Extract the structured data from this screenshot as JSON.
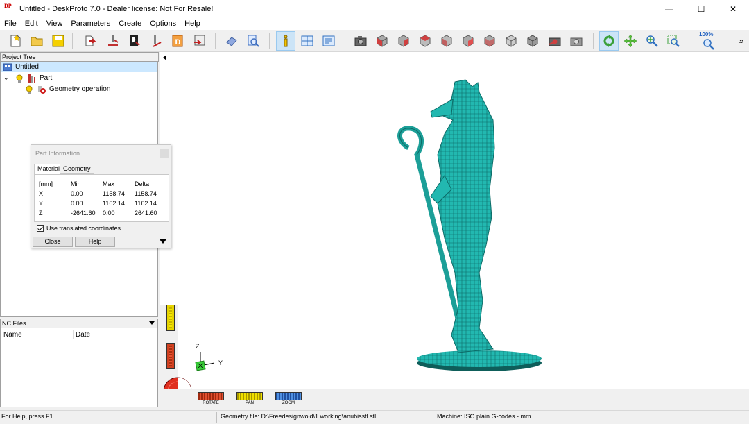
{
  "window": {
    "title": "Untitled - DeskProto 7.0 - Dealer license: Not For Resale!",
    "logo_text": "DP",
    "minimize": "—",
    "maximize": "☐",
    "close": "✕"
  },
  "menu": [
    "File",
    "Edit",
    "View",
    "Parameters",
    "Create",
    "Options",
    "Help"
  ],
  "toolbar": {
    "zoom_text": "100%",
    "overflow": "»"
  },
  "project_tree": {
    "header": "Project Tree",
    "root": "Untitled",
    "part": "Part",
    "operation": "Geometry operation"
  },
  "nc_files": {
    "header": "NC Files",
    "col_name": "Name",
    "col_date": "Date"
  },
  "part_info": {
    "title": "Part Information",
    "tabs": [
      "Material",
      "Geometry"
    ],
    "headers": [
      "[mm]",
      "Min",
      "Max",
      "Delta"
    ],
    "rows": [
      [
        "X",
        "0.00",
        "1158.74",
        "1158.74"
      ],
      [
        "Y",
        "0.00",
        "1162.14",
        "1162.14"
      ],
      [
        "Z",
        "-2641.60",
        "0.00",
        "2641.60"
      ]
    ],
    "checkbox_label": "Use translated coordinates",
    "close_label": "Close",
    "help_label": "Help"
  },
  "viewport": {
    "axis_z": "Z",
    "axis_y": "Y",
    "model_color": "#1fb3ad",
    "nav": [
      "ROTATE",
      "PAN",
      "ZOOM"
    ]
  },
  "status": {
    "help": "For Help, press F1",
    "geometry": "Geometry file: D:\\Freedesignwold\\1.working\\anubisstl.stl",
    "machine": "Machine: ISO plain G-codes - mm"
  }
}
